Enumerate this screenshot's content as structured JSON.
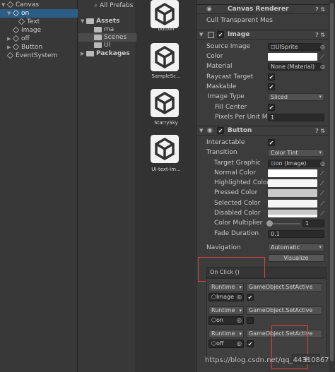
{
  "hierarchy": {
    "items": [
      {
        "label": "Canvas",
        "indent": 0
      },
      {
        "label": "on",
        "indent": 1
      },
      {
        "label": "Text",
        "indent": 2
      },
      {
        "label": "Image",
        "indent": 1
      },
      {
        "label": "off",
        "indent": 1
      },
      {
        "label": "Button",
        "indent": 1
      },
      {
        "label": "EventSystem",
        "indent": 0
      }
    ]
  },
  "project": {
    "all_prefabs": "All Prefabs",
    "assets": "Assets",
    "folders": [
      "ma",
      "Scenes",
      "UI"
    ],
    "packages": "Packages"
  },
  "assets_grid": {
    "items": [
      "button",
      "SampleSc...",
      "StarrySky",
      "UI-text-im..."
    ]
  },
  "inspector": {
    "canvas_renderer": {
      "title": "Canvas Renderer",
      "cull_label": "Cull Transparent Mes"
    },
    "image": {
      "title": "Image",
      "source_image_label": "Source Image",
      "source_image_value": "UISprite",
      "color_label": "Color",
      "material_label": "Material",
      "material_value": "None (Material)",
      "raycast_label": "Raycast Target",
      "maskable_label": "Maskable",
      "image_type_label": "Image Type",
      "image_type_value": "Sliced",
      "fill_center_label": "Fill Center",
      "ppu_label": "Pixels Per Unit Mul",
      "ppu_value": "1"
    },
    "button": {
      "title": "Button",
      "interactable_label": "Interactable",
      "transition_label": "Transition",
      "transition_value": "Color Tint",
      "target_graphic_label": "Target Graphic",
      "target_graphic_value": "on (Image)",
      "normal_label": "Normal Color",
      "highlighted_label": "Highlighted Color",
      "pressed_label": "Pressed Color",
      "selected_label": "Selected Color",
      "disabled_label": "Disabled Color",
      "multiplier_label": "Color Multiplier",
      "multiplier_value": "1",
      "fade_label": "Fade Duration",
      "fade_value": "0.1",
      "navigation_label": "Navigation",
      "navigation_value": "Automatic",
      "visualize_label": "Visualize",
      "on_click_label": "On Click ()",
      "events": [
        {
          "runtime": "Runtime",
          "function": "GameObject.SetActive",
          "object": "Image"
        },
        {
          "runtime": "Runtime",
          "function": "GameObject.SetActive",
          "object": "on"
        },
        {
          "runtime": "Runtime",
          "function": "GameObject.SetActive",
          "object": "off"
        }
      ],
      "add_label": "+"
    }
  },
  "watermark": "https://blog.csdn.net/qq_44310867"
}
